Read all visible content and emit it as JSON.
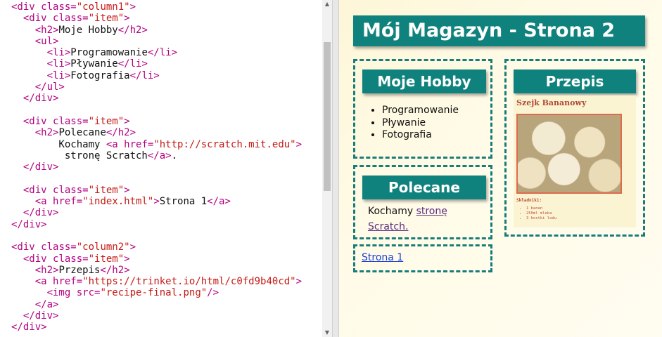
{
  "editor": {
    "lines": [
      [
        {
          "t": "tag",
          "v": "<div "
        },
        {
          "t": "attr",
          "v": "class="
        },
        {
          "t": "str",
          "v": "\"column1\""
        },
        {
          "t": "tag",
          "v": ">"
        }
      ],
      [
        {
          "t": "txt",
          "v": "  "
        },
        {
          "t": "tag",
          "v": "<div "
        },
        {
          "t": "attr",
          "v": "class="
        },
        {
          "t": "str",
          "v": "\"item\""
        },
        {
          "t": "tag",
          "v": ">"
        }
      ],
      [
        {
          "t": "txt",
          "v": "    "
        },
        {
          "t": "tag",
          "v": "<h2>"
        },
        {
          "t": "txt",
          "v": "Moje Hobby"
        },
        {
          "t": "tag",
          "v": "</h2>"
        }
      ],
      [
        {
          "t": "txt",
          "v": "    "
        },
        {
          "t": "tag",
          "v": "<ul>"
        }
      ],
      [
        {
          "t": "txt",
          "v": "      "
        },
        {
          "t": "tag",
          "v": "<li>"
        },
        {
          "t": "txt",
          "v": "Programowanie"
        },
        {
          "t": "tag",
          "v": "</li>"
        }
      ],
      [
        {
          "t": "txt",
          "v": "      "
        },
        {
          "t": "tag",
          "v": "<li>"
        },
        {
          "t": "txt",
          "v": "Pływanie"
        },
        {
          "t": "tag",
          "v": "</li>"
        }
      ],
      [
        {
          "t": "txt",
          "v": "      "
        },
        {
          "t": "tag",
          "v": "<li>"
        },
        {
          "t": "txt",
          "v": "Fotografia"
        },
        {
          "t": "tag",
          "v": "</li>"
        }
      ],
      [
        {
          "t": "txt",
          "v": "    "
        },
        {
          "t": "tag",
          "v": "</ul>"
        }
      ],
      [
        {
          "t": "txt",
          "v": "  "
        },
        {
          "t": "tag",
          "v": "</div>"
        }
      ],
      [],
      [
        {
          "t": "txt",
          "v": "  "
        },
        {
          "t": "tag",
          "v": "<div "
        },
        {
          "t": "attr",
          "v": "class="
        },
        {
          "t": "str",
          "v": "\"item\""
        },
        {
          "t": "tag",
          "v": ">"
        }
      ],
      [
        {
          "t": "txt",
          "v": "    "
        },
        {
          "t": "tag",
          "v": "<h2>"
        },
        {
          "t": "txt",
          "v": "Polecane"
        },
        {
          "t": "tag",
          "v": "</h2>"
        }
      ],
      [
        {
          "t": "txt",
          "v": "        Kochamy "
        },
        {
          "t": "tag",
          "v": "<a "
        },
        {
          "t": "attr",
          "v": "href="
        },
        {
          "t": "str",
          "v": "\"http://scratch.mit.edu\""
        },
        {
          "t": "tag",
          "v": ">"
        }
      ],
      [
        {
          "t": "txt",
          "v": "         stronę Scratch"
        },
        {
          "t": "tag",
          "v": "</a>"
        },
        {
          "t": "txt",
          "v": "."
        }
      ],
      [
        {
          "t": "txt",
          "v": "  "
        },
        {
          "t": "tag",
          "v": "</div>"
        }
      ],
      [],
      [
        {
          "t": "txt",
          "v": "  "
        },
        {
          "t": "tag",
          "v": "<div "
        },
        {
          "t": "attr",
          "v": "class="
        },
        {
          "t": "str",
          "v": "\"item\""
        },
        {
          "t": "tag",
          "v": ">"
        }
      ],
      [
        {
          "t": "txt",
          "v": "    "
        },
        {
          "t": "tag",
          "v": "<a "
        },
        {
          "t": "attr",
          "v": "href="
        },
        {
          "t": "str",
          "v": "\"index.html\""
        },
        {
          "t": "tag",
          "v": ">"
        },
        {
          "t": "txt",
          "v": "Strona 1"
        },
        {
          "t": "tag",
          "v": "</a>"
        }
      ],
      [
        {
          "t": "txt",
          "v": "  "
        },
        {
          "t": "tag",
          "v": "</div>"
        }
      ],
      [
        {
          "t": "tag",
          "v": "</div>"
        }
      ],
      [],
      [
        {
          "t": "tag",
          "v": "<div "
        },
        {
          "t": "attr",
          "v": "class="
        },
        {
          "t": "str",
          "v": "\"column2\""
        },
        {
          "t": "tag",
          "v": ">"
        }
      ],
      [
        {
          "t": "txt",
          "v": "  "
        },
        {
          "t": "tag",
          "v": "<div "
        },
        {
          "t": "attr",
          "v": "class="
        },
        {
          "t": "str",
          "v": "\"item\""
        },
        {
          "t": "tag",
          "v": ">"
        }
      ],
      [
        {
          "t": "txt",
          "v": "    "
        },
        {
          "t": "tag",
          "v": "<h2>"
        },
        {
          "t": "txt",
          "v": "Przepis"
        },
        {
          "t": "tag",
          "v": "</h2>"
        }
      ],
      [
        {
          "t": "txt",
          "v": "    "
        },
        {
          "t": "tag",
          "v": "<a "
        },
        {
          "t": "attr",
          "v": "href="
        },
        {
          "t": "str",
          "v": "\"https://trinket.io/html/c0fd9b40cd\""
        },
        {
          "t": "tag",
          "v": ">"
        }
      ],
      [
        {
          "t": "txt",
          "v": "      "
        },
        {
          "t": "tag",
          "v": "<img "
        },
        {
          "t": "attr",
          "v": "src="
        },
        {
          "t": "str",
          "v": "\"recipe-final.png\""
        },
        {
          "t": "tag",
          "v": "/>"
        }
      ],
      [
        {
          "t": "txt",
          "v": "    "
        },
        {
          "t": "tag",
          "v": "</a>"
        }
      ],
      [
        {
          "t": "txt",
          "v": "  "
        },
        {
          "t": "tag",
          "v": "</div>"
        }
      ],
      [
        {
          "t": "tag",
          "v": "</div>"
        }
      ]
    ]
  },
  "preview": {
    "page_title": "Mój Magazyn - Strona 2",
    "hobby": {
      "heading": "Moje Hobby",
      "items": [
        "Programowanie",
        "Pływanie",
        "Fotografia"
      ]
    },
    "polecane": {
      "heading": "Polecane",
      "text_before": "Kochamy ",
      "link_line1": "stronę",
      "link_line2": "Scratch."
    },
    "page_link": "Strona 1",
    "recipe": {
      "heading": "Przepis",
      "card_title": "Szejk Bananowy",
      "ingredients_title": "Składniki:",
      "ingredients": [
        "1 banan",
        "250ml mleka",
        "3 kostki lodu"
      ]
    }
  },
  "colors": {
    "header_bg": "#10827d",
    "dashed_border": "#177d7b",
    "code_tag": "#b30080",
    "code_string": "#c41a16"
  }
}
